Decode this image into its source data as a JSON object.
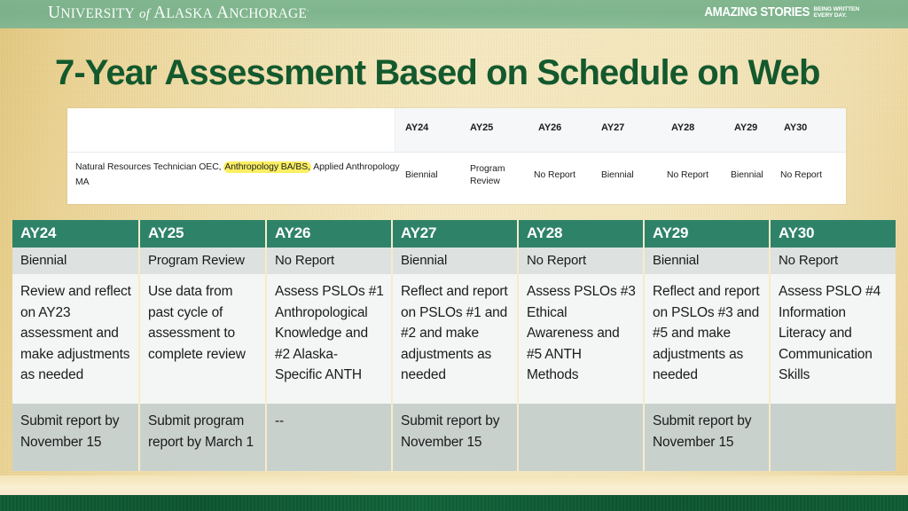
{
  "banner": {
    "logo": {
      "word1_cap": "U",
      "word1_rest": "NIVERSITY",
      "of": "of",
      "word2_cap": "A",
      "word2_rest": "LASKA",
      "word3_cap": "A",
      "word3_rest": "NCHORAGE",
      "period": "."
    },
    "tagline_main": "AMAZING STORIES",
    "tagline_sub_line1": "BEING WRITTEN",
    "tagline_sub_line2": "EVERY DAY."
  },
  "title": "7-Year Assessment Based on Schedule on Web",
  "screenshot": {
    "program_prefix": "Natural Resources Technician OEC, ",
    "program_highlighted": "Anthropology BA/BS,",
    "program_suffix": " Applied Anthropology MA",
    "columns": [
      "AY24",
      "AY25",
      "AY26",
      "AY27",
      "AY28",
      "AY29",
      "AY30"
    ],
    "values": [
      "Biennial",
      "Program Review",
      "No Report",
      "Biennial",
      "No Report",
      "Biennial",
      "No Report"
    ],
    "col_x": [
      457,
      530,
      607,
      678,
      757,
      828,
      884
    ],
    "cell_x": [
      457,
      530,
      602,
      678,
      752,
      824,
      880
    ],
    "cell_widths": [
      70,
      50,
      70,
      70,
      70,
      56,
      70
    ]
  },
  "table": {
    "headers": [
      "AY24",
      "AY25",
      "AY26",
      "AY27",
      "AY28",
      "AY29",
      "AY30"
    ],
    "status_row": [
      "Biennial",
      "Program Review",
      "No Report",
      "Biennial",
      "No Report",
      "Biennial",
      "No Report"
    ],
    "activity_row": [
      "Review and reflect on AY23 assessment and make adjustments as needed",
      "Use data from past cycle of assessment to complete review",
      "Assess PSLOs #1 Anthropological Knowledge and #2 Alaska-Specific ANTH",
      "Reflect and report on PSLOs #1 and #2 and make adjustments as needed",
      "Assess PSLOs #3 Ethical Awareness and #5 ANTH Methods",
      "Reflect and report on PSLOs #3 and #5 and make adjustments as needed",
      "Assess PSLO #4 Information Literacy and Communication Skills"
    ],
    "deadline_row": [
      "Submit report by November 15",
      "Submit program report by March 1",
      "--",
      "Submit report by November 15",
      "",
      "Submit report by November 15",
      ""
    ]
  },
  "colors": {
    "banner_green": "#82b78f",
    "title_green": "#14592e",
    "header_teal": "#2e8268",
    "status_gray": "#dde2e0",
    "activity_white": "#f4f6f5",
    "deadline_gray": "#c9d1cd",
    "footer_green": "#0f5c33",
    "highlight_yellow": "#fbef62",
    "background_tan": "#f4e3b4"
  }
}
